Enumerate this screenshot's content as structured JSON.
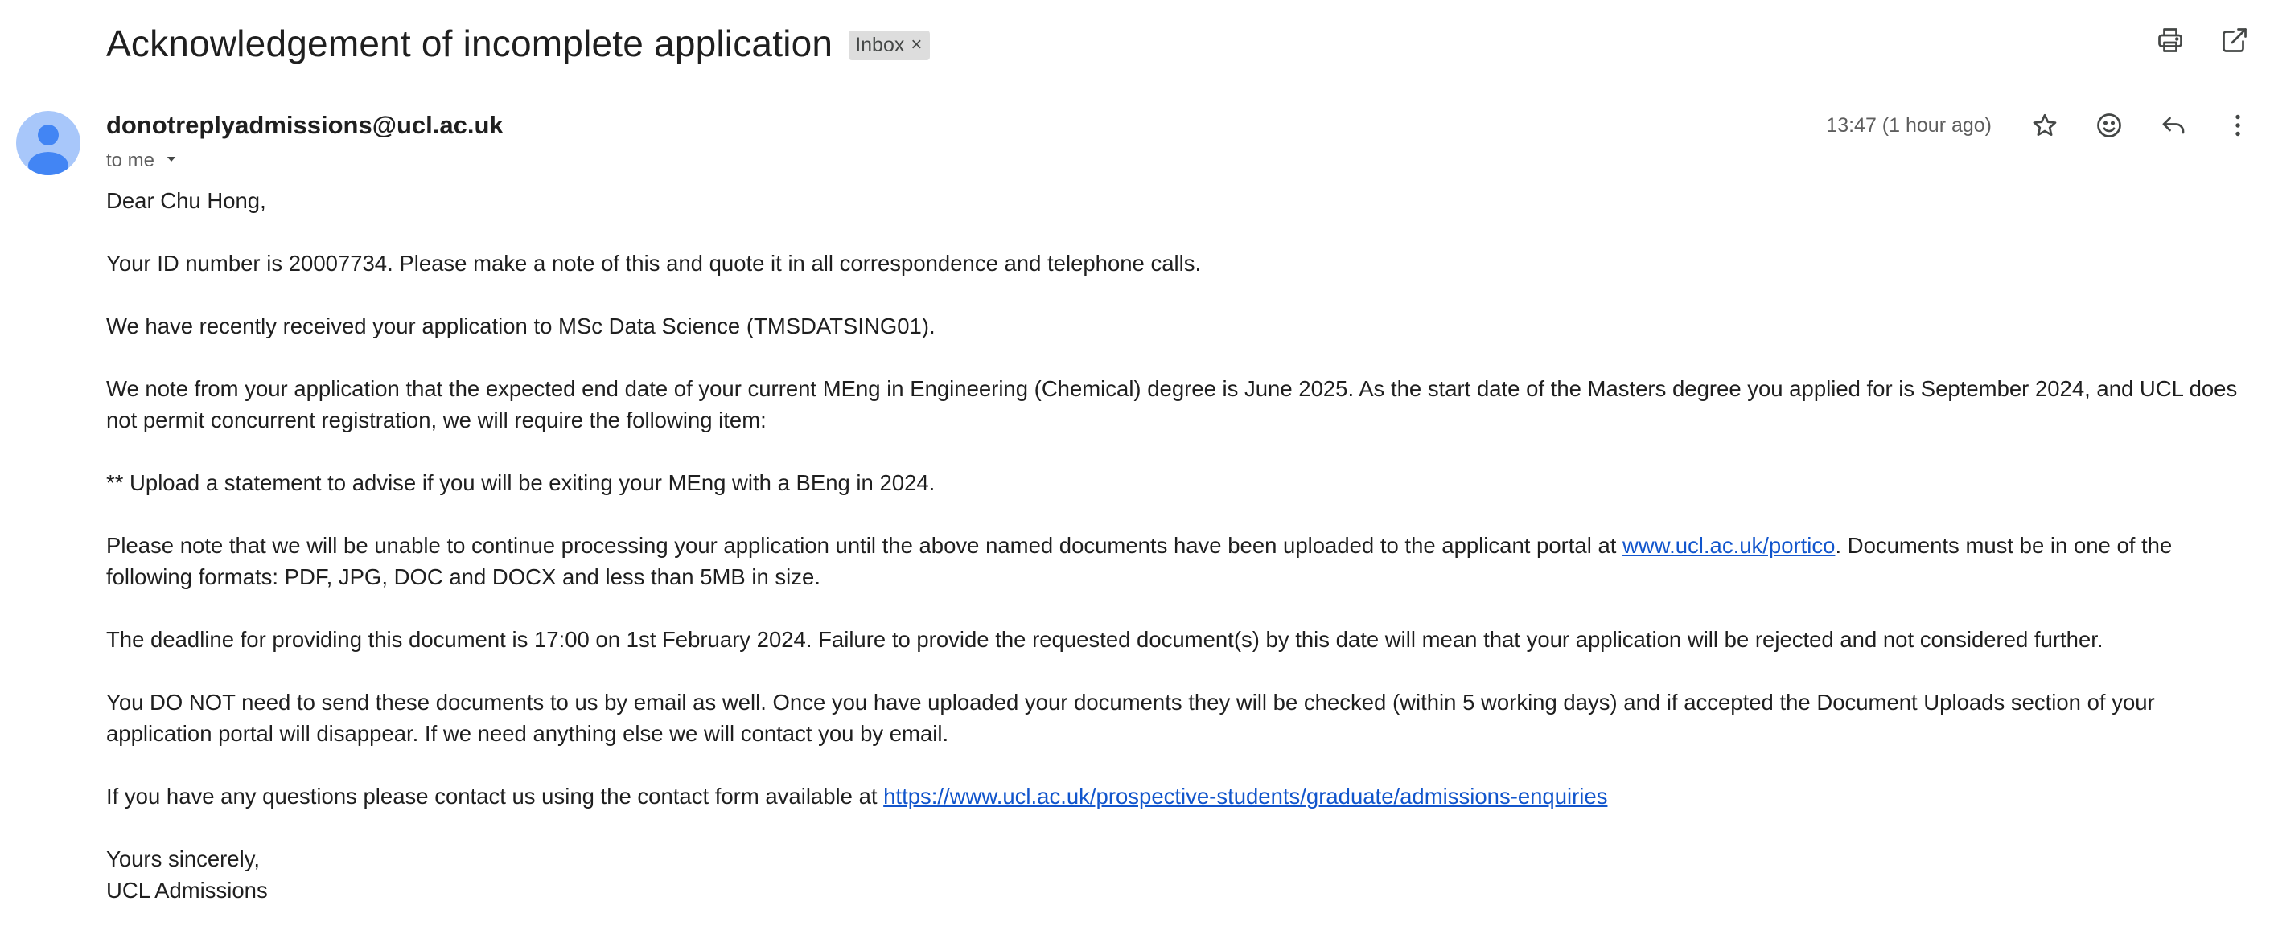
{
  "email": {
    "subject": "Acknowledgement of incomplete application",
    "label": "Inbox",
    "label_remove": "×",
    "sender": "donotreplyadmissions@ucl.ac.uk",
    "recipient": "to me",
    "timestamp": "13:47 (1 hour ago)",
    "body": {
      "greeting": "Dear Chu Hong,",
      "p_id": "Your ID number is 20007734. Please make a note of this and quote it in all correspondence and telephone calls.",
      "p_received": "We have recently received your application to MSc Data Science (TMSDATSING01).",
      "p_note": "We note from your application that the expected end date of your current MEng in Engineering (Chemical) degree is June 2025. As the start date of the Masters degree you applied for is September 2024, and UCL does not permit concurrent registration, we will require the following item:",
      "p_upload": "** Upload a statement to advise if you will be exiting your MEng with a BEng in 2024.",
      "p_portal_before": "Please note that we will be unable to continue processing your application until the above named documents have been uploaded to the applicant portal at ",
      "p_portal_link": "www.ucl.ac.uk/portico",
      "p_portal_after": ". Documents must be in one of the following formats: PDF, JPG, DOC and DOCX and less than 5MB in size.",
      "p_deadline": "The deadline for providing this document is 17:00 on 1st February 2024. Failure to provide the requested document(s) by this date will mean that your application will be rejected and not considered further.",
      "p_donot": "You DO NOT need to send these documents to us by email as well. Once you have uploaded your documents they will be checked (within 5 working days) and if accepted the Document Uploads section of your application portal will disappear. If we need anything else we will contact you by email.",
      "p_questions_before": "If you have any questions please contact us using the contact form available at ",
      "p_questions_link": "https://www.ucl.ac.uk/prospective-students/graduate/admissions-enquiries",
      "signoff": "Yours sincerely,",
      "signature": "UCL Admissions"
    }
  },
  "icons": {
    "print": "print-icon",
    "open_new_window": "open-in-new-window-icon",
    "star": "star-icon",
    "emoji": "emoji-reaction-icon",
    "reply": "reply-icon",
    "more": "more-vert-icon",
    "recipient_details": "chevron-down-icon"
  },
  "colors": {
    "avatar": "#a8c7fa",
    "avatar_figure": "#4285f4",
    "label_chip": "#dddddd",
    "link": "#1155cc"
  }
}
